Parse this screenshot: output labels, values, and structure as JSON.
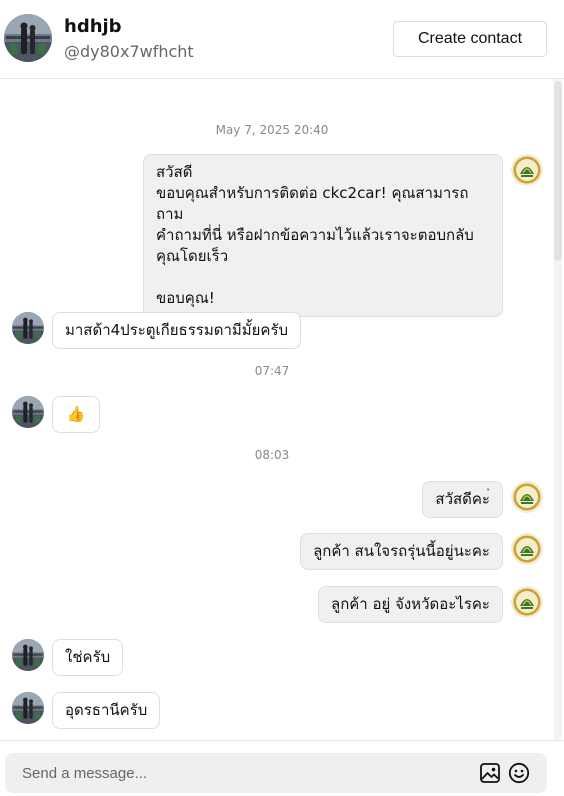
{
  "header": {
    "name": "hdhjb",
    "handle": "@dy80x7wfhcht",
    "create_contact_label": "Create contact"
  },
  "messages": {
    "timestamp_1": "May 7, 2025 20:40",
    "greeting": "สวัสดี\nขอบคุณสำหรับการติดต่อ ckc2car! คุณสามารถถาม\nคำถามที่นี่ หรือฝากข้อความไว้แล้วเราจะตอบกลับ\nคุณโดยเร็ว\n\nขอบคุณ!",
    "in_1": "มาสด้า4ประตูเกียธรรมดามีมั้ยครับ",
    "timestamp_2": "07:47",
    "in_2": "👍",
    "timestamp_3": "08:03",
    "out_1": "สวัสดีคะ่",
    "out_2": "ลูกค้า สนใจรถรุ่นนี้อยู่นะคะ",
    "out_3": "ลูกค้า อยู่ จังหวัดอะไรคะ",
    "in_3": "ใช่ครับ",
    "in_4": "อุดรธานีครับ"
  },
  "composer": {
    "placeholder": "Send a message..."
  },
  "colors": {
    "outgoing_bubble": "#f0f0f0",
    "incoming_bubble": "#ffffff",
    "border": "#dedede",
    "timestamp": "#8a8a8a"
  }
}
